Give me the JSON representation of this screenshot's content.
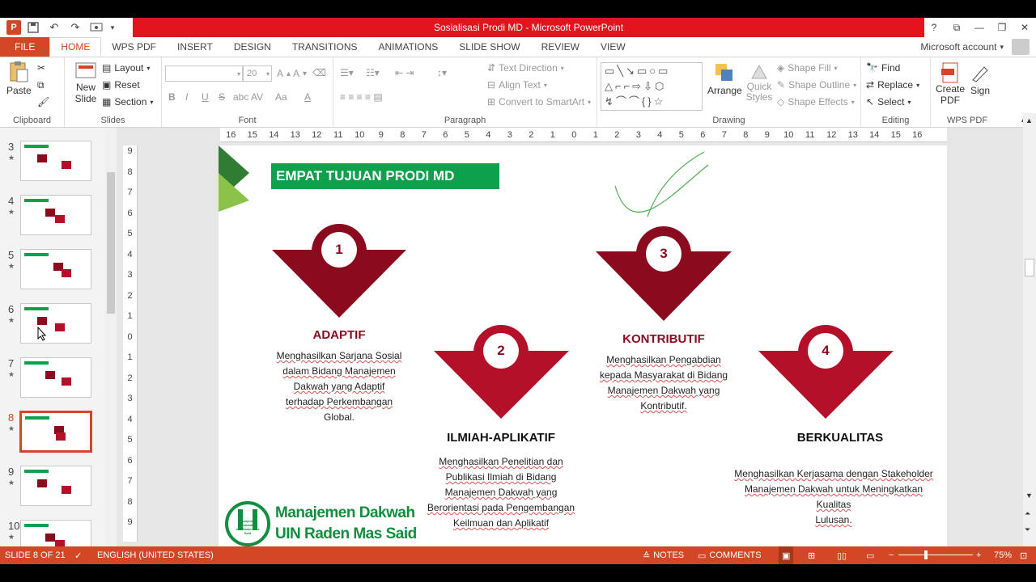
{
  "window": {
    "title": "Sosialisasi Prodi MD  -  Microsoft PowerPoint",
    "controls": [
      "?",
      "⧉",
      "—",
      "❐",
      "✕"
    ]
  },
  "qat": {
    "undo": "↶",
    "redo": "↷",
    "logo": "P"
  },
  "tabs": [
    "FILE",
    "HOME",
    "WPS PDF",
    "INSERT",
    "DESIGN",
    "TRANSITIONS",
    "ANIMATIONS",
    "SLIDE SHOW",
    "REVIEW",
    "VIEW"
  ],
  "account": "Microsoft account",
  "ribbon": {
    "clipboard": {
      "paste": "Paste",
      "label": "Clipboard"
    },
    "slides": {
      "new_slide": "New Slide",
      "layout": "Layout",
      "reset": "Reset",
      "section": "Section",
      "label": "Slides"
    },
    "font": {
      "size": "20",
      "label": "Font",
      "bold": "B",
      "italic": "I",
      "underline": "U",
      "strike": "S",
      "shadow": "abc",
      "spacing": "AV",
      "case": "Aa",
      "color": "A"
    },
    "paragraph": {
      "text_direction": "Text Direction",
      "align_text": "Align Text",
      "convert": "Convert to SmartArt",
      "label": "Paragraph"
    },
    "drawing": {
      "arrange": "Arrange",
      "quick_styles": "Quick Styles",
      "shape_fill": "Shape Fill",
      "shape_outline": "Shape Outline",
      "shape_effects": "Shape Effects",
      "label": "Drawing"
    },
    "editing": {
      "find": "Find",
      "replace": "Replace",
      "select": "Select",
      "label": "Editing"
    },
    "wps": {
      "create_pdf": "Create PDF",
      "sign": "Sign",
      "label": "WPS PDF"
    }
  },
  "thumbnails": [
    {
      "num": "3",
      "selected": false
    },
    {
      "num": "4",
      "selected": false
    },
    {
      "num": "5",
      "selected": false
    },
    {
      "num": "6",
      "selected": false
    },
    {
      "num": "7",
      "selected": false
    },
    {
      "num": "8",
      "selected": true
    },
    {
      "num": "9",
      "selected": false
    },
    {
      "num": "10",
      "selected": false
    }
  ],
  "ruler": {
    "h": [
      "16",
      "15",
      "14",
      "13",
      "12",
      "11",
      "10",
      "9",
      "8",
      "7",
      "6",
      "5",
      "4",
      "3",
      "2",
      "1",
      "0",
      "1",
      "2",
      "3",
      "4",
      "5",
      "6",
      "7",
      "8",
      "9",
      "10",
      "11",
      "12",
      "13",
      "14",
      "15",
      "16"
    ],
    "v": [
      "9",
      "8",
      "7",
      "6",
      "5",
      "4",
      "3",
      "2",
      "1",
      "0",
      "1",
      "2",
      "3",
      "4",
      "5",
      "6",
      "7",
      "8",
      "9"
    ]
  },
  "slide": {
    "heading": "EMPAT TUJUAN PRODI MD",
    "blocks": [
      {
        "num": "1",
        "title": "ADAPTIF",
        "lines": [
          "Menghasilkan Sarjana Sosial",
          "dalam Bidang Manajemen",
          "Dakwah yang Adaptif",
          "terhadap Perkembangan",
          "Global."
        ]
      },
      {
        "num": "2",
        "title": "ILMIAH-APLIKATIF",
        "lines": [
          "Menghasilkan Penelitian dan",
          "Publikasi Ilmiah di Bidang",
          "Manajemen Dakwah yang",
          "Berorientasi pada Pengembangan",
          "Keilmuan dan Aplikatif"
        ]
      },
      {
        "num": "3",
        "title": "KONTRIBUTIF",
        "lines": [
          "Menghasilkan Pengabdian",
          "kepada Masyarakat di Bidang",
          "Manajemen Dakwah yang",
          "Kontributif."
        ]
      },
      {
        "num": "4",
        "title": "BERKUALITAS",
        "lines": [
          "Menghasilkan Kerjasama dengan Stakeholder",
          "Manajemen Dakwah untuk Meningkatkan Kualitas",
          "Lulusan."
        ]
      }
    ],
    "logo_line1": "Manajemen Dakwah",
    "logo_line2": "UIN Raden Mas Said",
    "logo_badge_1": "Manajemen Dakwah",
    "logo_badge_2": "UIN Raden Mas Said",
    "colors": {
      "accent_green": "#0da14b",
      "dark_red": "#8b0a1e",
      "red": "#b5102a"
    }
  },
  "status": {
    "slide": "SLIDE 8 OF 21",
    "language": "ENGLISH (UNITED STATES)",
    "notes": "NOTES",
    "comments": "COMMENTS",
    "zoom": "75%"
  }
}
